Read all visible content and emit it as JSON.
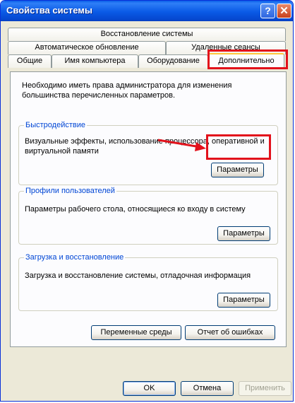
{
  "window": {
    "title": "Свойства системы"
  },
  "titlebar_buttons": {
    "help": "?",
    "close": "✕"
  },
  "tabs": {
    "row1": [
      {
        "label": "Восстановление системы"
      }
    ],
    "row2": [
      {
        "label": "Автоматическое обновление"
      },
      {
        "label": "Удаленные сеансы"
      }
    ],
    "row3": [
      {
        "label": "Общие"
      },
      {
        "label": "Имя компьютера"
      },
      {
        "label": "Оборудование"
      },
      {
        "label": "Дополнительно",
        "active": true
      }
    ]
  },
  "panel": {
    "info": "Необходимо иметь права администратора для изменения большинства перечисленных параметров.",
    "groups": [
      {
        "title": "Быстродействие",
        "description": "Визуальные эффекты, использование процессора, оперативной и виртуальной памяти",
        "button": "Параметры"
      },
      {
        "title": "Профили пользователей",
        "description": "Параметры рабочего стола, относящиеся ко входу в систему",
        "button": "Параметры"
      },
      {
        "title": "Загрузка и восстановление",
        "description": "Загрузка и восстановление системы, отладочная информация",
        "button": "Параметры"
      }
    ],
    "env_button": "Переменные среды",
    "error_button": "Отчет об ошибках"
  },
  "footer": {
    "ok": "OK",
    "cancel": "Отмена",
    "apply": "Применить",
    "apply_enabled": false
  },
  "annotation_color": "#e2111b"
}
